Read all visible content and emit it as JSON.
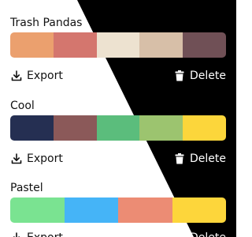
{
  "actions": {
    "export_label": "Export",
    "delete_label": "Delete"
  },
  "palettes": [
    {
      "name": "Trash Pandas",
      "colors": [
        "#EBA06E",
        "#D4766E",
        "#EDE2D0",
        "#D7BFA8",
        "#705056"
      ]
    },
    {
      "name": "Cool",
      "colors": [
        "#252F52",
        "#8B5959",
        "#5BBD7C",
        "#9CC46F",
        "#FCD63B"
      ]
    },
    {
      "name": "Pastel",
      "colors": [
        "#7AE391",
        "#45B4F7",
        "#EC8C74",
        "#FDD63B"
      ]
    }
  ]
}
